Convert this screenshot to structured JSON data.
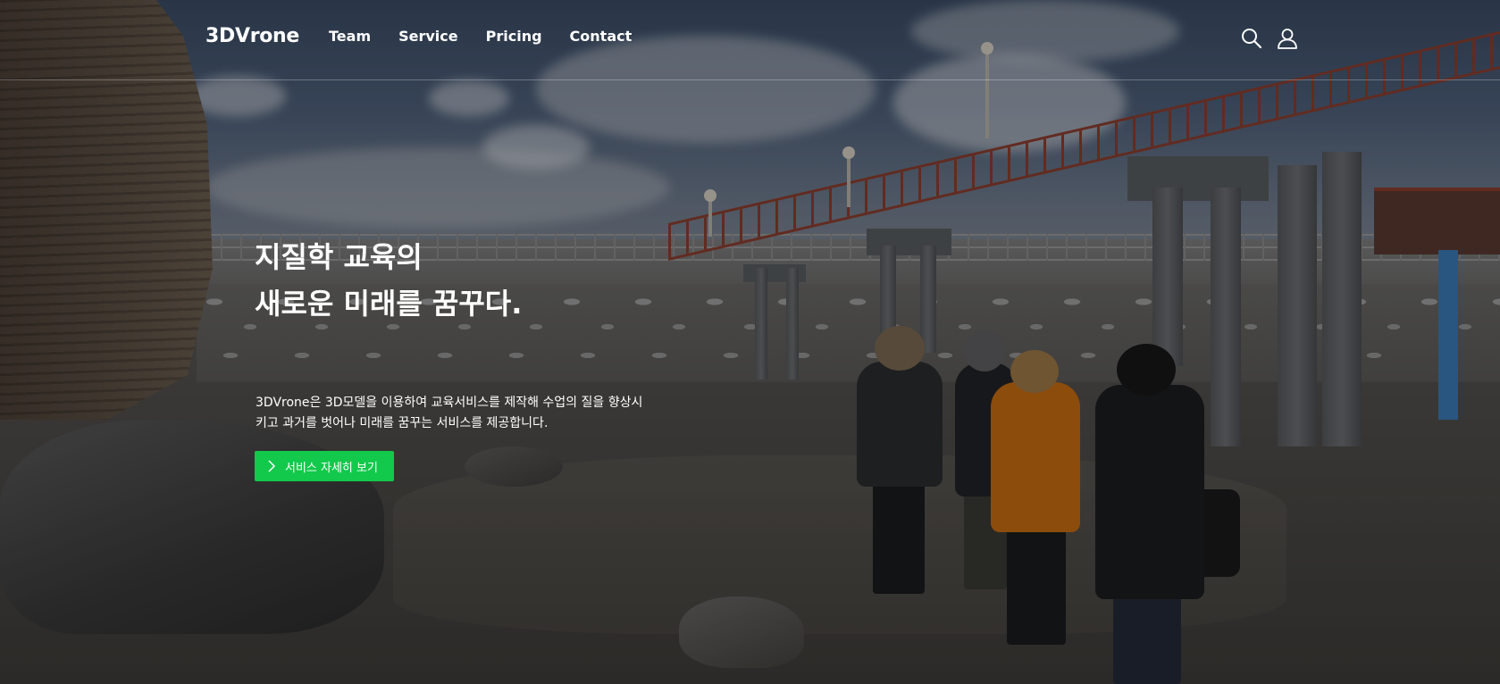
{
  "header": {
    "logo": "3DVrone",
    "nav": [
      "Team",
      "Service",
      "Pricing",
      "Contact"
    ]
  },
  "hero": {
    "headline": [
      "지질학 교육의",
      "새로운 미래를 꿈꾸다."
    ],
    "description": [
      "3DVrone은 3D모델을 이용하여 교육서비스를 제작해 수업의 질을 향상시",
      "키고 과거를 벗어나 미래를 꿈꾸는 서비스를 제공합니다."
    ],
    "cta_label": "서비스 자세히 보기"
  },
  "icons": {
    "search": "search-icon",
    "user": "user-icon",
    "cta": "chevron-right-icon"
  },
  "colors": {
    "accent": "#12c94b",
    "text": "#ffffff"
  }
}
